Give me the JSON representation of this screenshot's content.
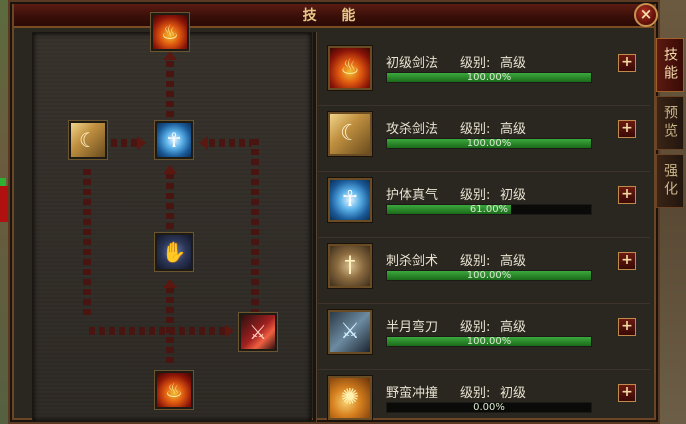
{
  "window": {
    "title": "技 能",
    "close_label": "×"
  },
  "tabs": [
    {
      "label": "技能",
      "active": true
    },
    {
      "label": "预览",
      "active": false
    },
    {
      "label": "强化",
      "active": false
    }
  ],
  "tree_nodes": [
    {
      "id": "top-fire",
      "icon": "fire-icon",
      "glyph": "♨"
    },
    {
      "id": "left-slash",
      "icon": "slash-icon",
      "glyph": "☾"
    },
    {
      "id": "center-shield",
      "icon": "shield-icon",
      "glyph": "☥"
    },
    {
      "id": "middle-claw",
      "icon": "claw-icon",
      "glyph": "✋"
    },
    {
      "id": "right-blade",
      "icon": "blade-icon",
      "glyph": "⚔"
    },
    {
      "id": "bottom-fire",
      "icon": "fire-icon",
      "glyph": "♨"
    }
  ],
  "level_label": "级别:",
  "skills": [
    {
      "name": "初级剑法",
      "level": "高级",
      "progress": "100.00%",
      "fraction": 1.0,
      "icon": "fire-icon",
      "glyph": "♨",
      "style": "icon-fire",
      "plus": "+"
    },
    {
      "name": "攻杀剑法",
      "level": "高级",
      "progress": "100.00%",
      "fraction": 1.0,
      "icon": "slash-icon",
      "glyph": "☾",
      "style": "icon-slash",
      "plus": "+"
    },
    {
      "name": "护体真气",
      "level": "初级",
      "progress": "61.00%",
      "fraction": 0.61,
      "icon": "shield-icon",
      "glyph": "☥",
      "style": "icon-shield",
      "plus": "+"
    },
    {
      "name": "刺杀剑术",
      "level": "高级",
      "progress": "100.00%",
      "fraction": 1.0,
      "icon": "sword-icon",
      "glyph": "†",
      "style": "icon-sword",
      "plus": "+"
    },
    {
      "name": "半月弯刀",
      "level": "高级",
      "progress": "100.00%",
      "fraction": 1.0,
      "icon": "crescent-blade-icon",
      "glyph": "⚔",
      "style": "icon-crescent",
      "plus": "+"
    },
    {
      "name": "野蛮冲撞",
      "level": "初级",
      "progress": "0.00%",
      "fraction": 0.0,
      "icon": "rush-icon",
      "glyph": "✺",
      "style": "icon-rush",
      "plus": "+"
    }
  ]
}
